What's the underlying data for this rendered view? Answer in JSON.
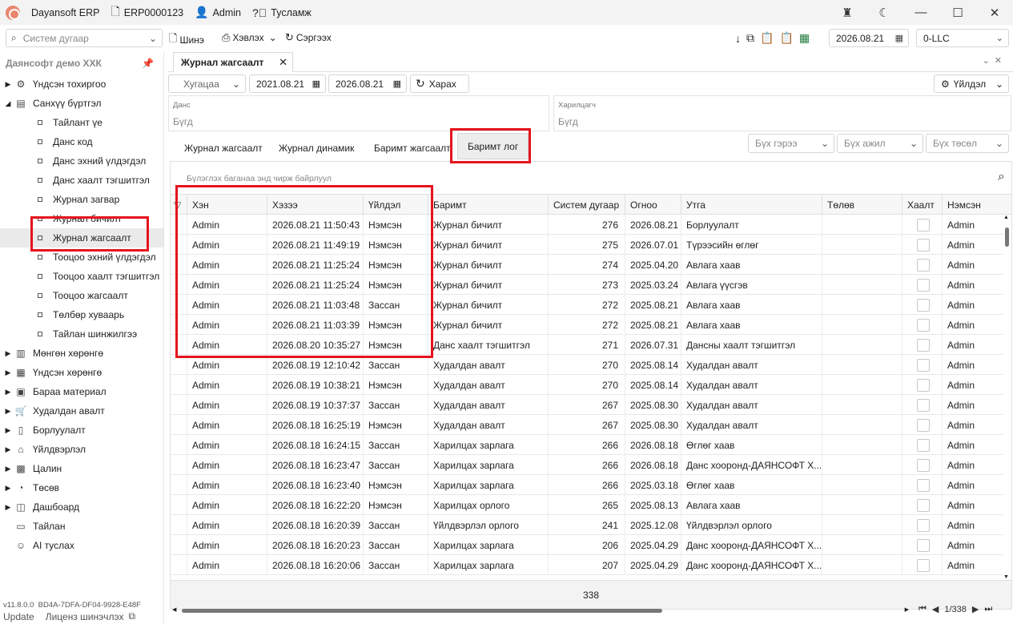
{
  "titlebar": {
    "app_name": "Dayansoft ERP",
    "erp_code": "ERP0000123",
    "user": "Admin",
    "help": "Тусламж"
  },
  "toolbar": {
    "search_placeholder": "Систем дугаар",
    "new_label": "Шинэ",
    "print_label": "Хэвлэх",
    "refresh_label": "Сэргээх",
    "date": "2026.08.21",
    "company": "0-LLC"
  },
  "sidebar": {
    "title": "Даянсофт демо ХХК",
    "version": "v11.8.0.0",
    "machine_id": "BD4A-7DFA-DF04-9928-E48F",
    "update_label": "Update",
    "license_label": "Лиценз шинэчлэх",
    "items": [
      {
        "label": "Үндсэн тохиргоо",
        "icon": "gear-icon",
        "level": 0,
        "expanded": false
      },
      {
        "label": "Санхүү бүртгэл",
        "icon": "ledger-icon",
        "level": 0,
        "expanded": true
      },
      {
        "label": "Тайлант үе",
        "level": 1
      },
      {
        "label": "Данс код",
        "level": 1
      },
      {
        "label": "Данс эхний үлдэгдэл",
        "level": 1
      },
      {
        "label": "Данс хаалт тэгшитгэл",
        "level": 1
      },
      {
        "label": "Журнал загвар",
        "level": 1
      },
      {
        "label": "Журнал бичилт",
        "level": 1
      },
      {
        "label": "Журнал жагсаалт",
        "level": 1,
        "active": true
      },
      {
        "label": "Тооцоо эхний үлдэгдэл",
        "level": 1
      },
      {
        "label": "Тооцоо хаалт тэгшитгэл",
        "level": 1
      },
      {
        "label": "Тооцоо жагсаалт",
        "level": 1
      },
      {
        "label": "Төлбөр хуваарь",
        "level": 1
      },
      {
        "label": "Тайлан шинжилгээ",
        "level": 1
      },
      {
        "label": "Мөнгөн хөрөнгө",
        "icon": "cash-icon",
        "level": 0,
        "expanded": false
      },
      {
        "label": "Үндсэн хөрөнгө",
        "icon": "building-icon",
        "level": 0,
        "expanded": false
      },
      {
        "label": "Бараа материал",
        "icon": "box-icon",
        "level": 0,
        "expanded": false
      },
      {
        "label": "Худалдан авалт",
        "icon": "cart-icon",
        "level": 0,
        "expanded": false
      },
      {
        "label": "Борлуулалт",
        "icon": "receipt-icon",
        "level": 0,
        "expanded": false
      },
      {
        "label": "Үйлдвэрлэл",
        "icon": "factory-icon",
        "level": 0,
        "expanded": false
      },
      {
        "label": "Цалин",
        "icon": "calculator-icon",
        "level": 0,
        "expanded": false
      },
      {
        "label": "Төсөв",
        "icon": "pie-icon",
        "level": 0,
        "expanded": false
      },
      {
        "label": "Дашбоард",
        "icon": "dashboard-icon",
        "level": 0,
        "expanded": false
      },
      {
        "label": "Тайлан",
        "icon": "report-icon",
        "level": 0,
        "leaf": true
      },
      {
        "label": "AI туслах",
        "icon": "robot-icon",
        "level": 0,
        "leaf": true
      }
    ]
  },
  "doc_tab": {
    "label": "Журнал жагсаалт"
  },
  "filters": {
    "period_label": "Хугацаа",
    "date_from": "2021.08.21",
    "date_to": "2026.08.21",
    "view_label": "Харах",
    "action_label": "Үйлдэл",
    "account_label": "Данс",
    "account_value": "Бүгд",
    "partner_label": "Харилцагч",
    "partner_value": "Бүгд"
  },
  "subtabs": [
    "Журнал жагсаалт",
    "Журнал динамик",
    "Баримт жагсаалт",
    "Баримт лог"
  ],
  "combos": [
    "Бүх гэрээ",
    "Бүх ажил",
    "Бүх төсөл"
  ],
  "grid": {
    "group_hint": "Бүлэглэх баганаа энд чирж байрлуул",
    "columns": [
      "Хэн",
      "Хэзээ",
      "Үйлдэл",
      "Баримт",
      "Систем дугаар",
      "Огноо",
      "Утга",
      "Төлөв",
      "Хаалт",
      "Нэмсэн"
    ],
    "rows": [
      [
        "Admin",
        "2026.08.21 11:50:43",
        "Нэмсэн",
        "Журнал бичилт",
        "276",
        "2026.08.21",
        "Борлуулалт",
        "",
        "",
        "Admin"
      ],
      [
        "Admin",
        "2026.08.21 11:49:19",
        "Нэмсэн",
        "Журнал бичилт",
        "275",
        "2026.07.01",
        "Түрээсийн өглөг",
        "",
        "",
        "Admin"
      ],
      [
        "Admin",
        "2026.08.21 11:25:24",
        "Нэмсэн",
        "Журнал бичилт",
        "274",
        "2025.04.20",
        "Авлага хаав",
        "",
        "",
        "Admin"
      ],
      [
        "Admin",
        "2026.08.21 11:25:24",
        "Нэмсэн",
        "Журнал бичилт",
        "273",
        "2025.03.24",
        "Авлага үүсгэв",
        "",
        "",
        "Admin"
      ],
      [
        "Admin",
        "2026.08.21 11:03:48",
        "Зассан",
        "Журнал бичилт",
        "272",
        "2025.08.21",
        "Авлага хаав",
        "",
        "",
        "Admin"
      ],
      [
        "Admin",
        "2026.08.21 11:03:39",
        "Нэмсэн",
        "Журнал бичилт",
        "272",
        "2025.08.21",
        "Авлага хаав",
        "",
        "",
        "Admin"
      ],
      [
        "Admin",
        "2026.08.20 10:35:27",
        "Нэмсэн",
        "Данс хаалт тэгшитгэл",
        "271",
        "2026.07.31",
        "Дансны хаалт тэгшитгэл",
        "",
        "",
        "Admin"
      ],
      [
        "Admin",
        "2026.08.19 12:10:42",
        "Зассан",
        "Худалдан авалт",
        "270",
        "2025.08.14",
        "Худалдан авалт",
        "",
        "",
        "Admin"
      ],
      [
        "Admin",
        "2026.08.19 10:38:21",
        "Нэмсэн",
        "Худалдан авалт",
        "270",
        "2025.08.14",
        "Худалдан авалт",
        "",
        "",
        "Admin"
      ],
      [
        "Admin",
        "2026.08.19 10:37:37",
        "Зассан",
        "Худалдан авалт",
        "267",
        "2025.08.30",
        "Худалдан авалт",
        "",
        "",
        "Admin"
      ],
      [
        "Admin",
        "2026.08.18 16:25:19",
        "Нэмсэн",
        "Худалдан авалт",
        "267",
        "2025.08.30",
        "Худалдан авалт",
        "",
        "",
        "Admin"
      ],
      [
        "Admin",
        "2026.08.18 16:24:15",
        "Зассан",
        "Харилцах зарлага",
        "266",
        "2026.08.18",
        "Өглөг хаав",
        "",
        "",
        "Admin"
      ],
      [
        "Admin",
        "2026.08.18 16:23:47",
        "Зассан",
        "Харилцах зарлага",
        "266",
        "2026.08.18",
        "Данс хооронд-ДАЯНСОФТ Х...",
        "",
        "",
        "Admin"
      ],
      [
        "Admin",
        "2026.08.18 16:23:40",
        "Нэмсэн",
        "Харилцах зарлага",
        "266",
        "2025.03.18",
        "Өглөг хаав",
        "",
        "",
        "Admin"
      ],
      [
        "Admin",
        "2026.08.18 16:22:20",
        "Нэмсэн",
        "Харилцах орлого",
        "265",
        "2025.08.13",
        "Авлага хаав",
        "",
        "",
        "Admin"
      ],
      [
        "Admin",
        "2026.08.18 16:20:39",
        "Зассан",
        "Үйлдвэрлэл орлого",
        "241",
        "2025.12.08",
        "Үйлдвэрлэл орлого",
        "",
        "",
        "Admin"
      ],
      [
        "Admin",
        "2026.08.18 16:20:23",
        "Зассан",
        "Харилцах зарлага",
        "206",
        "2025.04.29",
        "Данс хооронд-ДАЯНСОФТ Х...",
        "",
        "",
        "Admin"
      ],
      [
        "Admin",
        "2026.08.18 16:20:06",
        "Зассан",
        "Харилцах зарлага",
        "207",
        "2025.04.29",
        "Данс хооронд-ДАЯНСОФТ Х...",
        "",
        "",
        "Admin"
      ]
    ],
    "total": "338",
    "pager": "1/338"
  },
  "colors": {
    "highlight": "#e5131d",
    "accent": "#1f6fd1"
  }
}
